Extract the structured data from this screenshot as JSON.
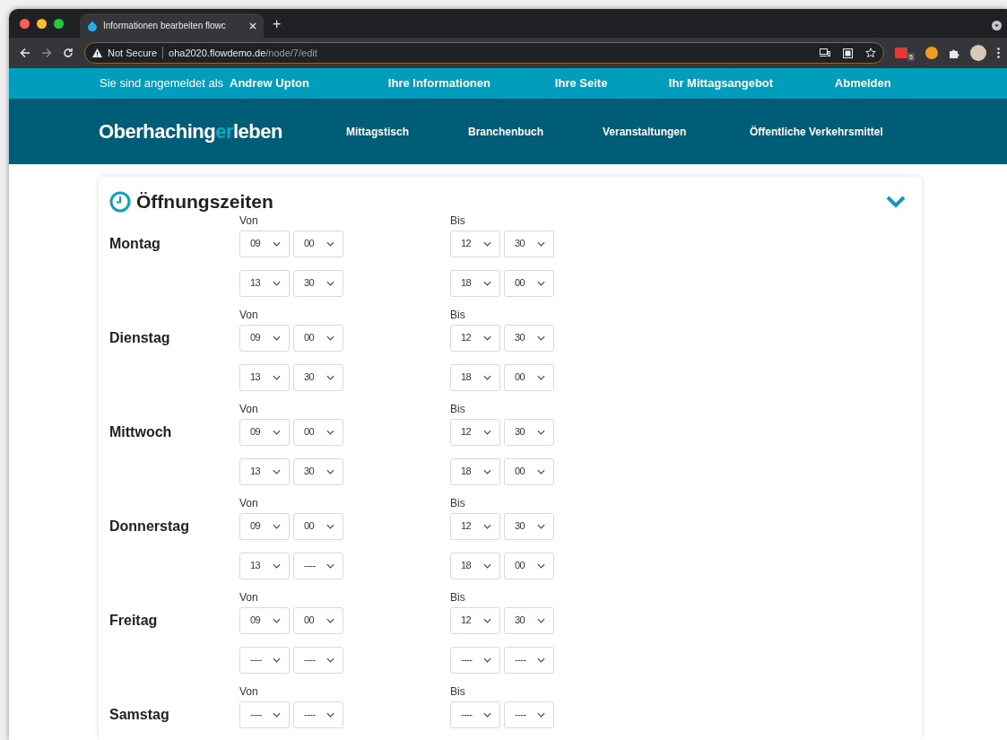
{
  "browser": {
    "tab_title": "Informationen bearbeiten flowc",
    "new_tab": "+",
    "security": "Not Secure",
    "url_host": "oha2020.flowdemo.de",
    "url_path": "/node/7/edit",
    "extension_badge": "5"
  },
  "topbar": {
    "greeting": "Sie sind angemeldet als",
    "user": "Andrew Upton",
    "links": [
      "Ihre Informationen",
      "Ihre Seite",
      "Ihr Mittagsangebot",
      "Abmelden"
    ]
  },
  "nav": {
    "logo": [
      {
        "text": "Oberhaching",
        "kind": "plain"
      },
      {
        "text": "er",
        "kind": "accent"
      },
      {
        "text": "leben",
        "kind": "plain"
      }
    ],
    "links": [
      "Mittagstisch",
      "Branchenbuch",
      "Veranstaltungen",
      "Öffentliche Verkehrsmittel"
    ]
  },
  "section": {
    "title": "Öffnungszeiten",
    "expanded": true,
    "days": [
      {
        "name": "Montag",
        "from_label": "Von",
        "to_label": "Bis",
        "slots": [
          {
            "from": [
              "09",
              "00"
            ],
            "to": [
              "12",
              "30"
            ]
          },
          {
            "from": [
              "13",
              "30"
            ],
            "to": [
              "18",
              "00"
            ]
          }
        ]
      },
      {
        "name": "Dienstag",
        "from_label": "Von",
        "to_label": "Bis",
        "slots": [
          {
            "from": [
              "09",
              "00"
            ],
            "to": [
              "12",
              "30"
            ]
          },
          {
            "from": [
              "13",
              "30"
            ],
            "to": [
              "18",
              "00"
            ]
          }
        ]
      },
      {
        "name": "Mittwoch",
        "from_label": "Von",
        "to_label": "Bis",
        "slots": [
          {
            "from": [
              "09",
              "00"
            ],
            "to": [
              "12",
              "30"
            ]
          },
          {
            "from": [
              "13",
              "30"
            ],
            "to": [
              "18",
              "00"
            ]
          }
        ]
      },
      {
        "name": "Donnerstag",
        "from_label": "Von",
        "to_label": "Bis",
        "slots": [
          {
            "from": [
              "09",
              "00"
            ],
            "to": [
              "12",
              "30"
            ]
          },
          {
            "from": [
              "13",
              "----"
            ],
            "to": [
              "18",
              "00"
            ]
          }
        ]
      },
      {
        "name": "Freitag",
        "from_label": "Von",
        "to_label": "Bis",
        "slots": [
          {
            "from": [
              "09",
              "00"
            ],
            "to": [
              "12",
              "30"
            ]
          },
          {
            "from": [
              "----",
              "----"
            ],
            "to": [
              "----",
              "----"
            ]
          }
        ]
      },
      {
        "name": "Samstag",
        "from_label": "Von",
        "to_label": "Bis",
        "slots": [
          {
            "from": [
              "----",
              "----"
            ],
            "to": [
              "----",
              "----"
            ]
          }
        ]
      }
    ]
  }
}
